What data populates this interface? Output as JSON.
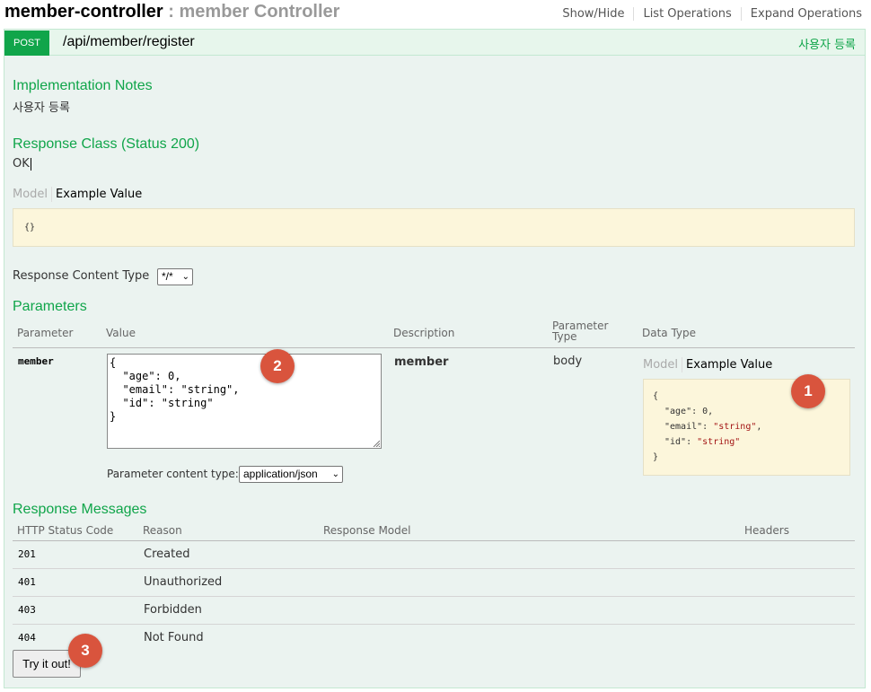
{
  "header": {
    "controller_name": "member-controller",
    "separator": " : ",
    "controller_description": "member Controller",
    "links": [
      "Show/Hide",
      "List Operations",
      "Expand Operations"
    ]
  },
  "operation": {
    "method": "POST",
    "path": "/api/member/register",
    "summary": "사용자 등록"
  },
  "implementation_notes": {
    "heading": "Implementation Notes",
    "text": "사용자 등록"
  },
  "response_class": {
    "heading": "Response Class (Status 200)",
    "text": "OK",
    "tab_model": "Model",
    "tab_example": "Example Value",
    "example": "{}"
  },
  "response_content_type": {
    "label": "Response Content Type",
    "value": "*/*"
  },
  "parameters": {
    "heading": "Parameters",
    "columns": [
      "Parameter",
      "Value",
      "Description",
      "Parameter Type",
      "Data Type"
    ],
    "rows": [
      {
        "name": "member",
        "value_lines": [
          "{",
          "  \"age\": 0,",
          "  \"email\": \"string\",",
          "  \"id\": \"string\"",
          "}"
        ],
        "description": "member",
        "param_type": "body",
        "tab_model": "Model",
        "tab_example": "Example Value",
        "example": {
          "open": "{",
          "age_key": "\"age\"",
          "age_val": "0,",
          "email_key": "\"email\"",
          "email_val": "\"string\"",
          "email_comma": ",",
          "id_key": "\"id\"",
          "id_val": "\"string\"",
          "close": "}"
        }
      }
    ],
    "content_type_label": "Parameter content type:",
    "content_type_value": "application/json"
  },
  "response_messages": {
    "heading": "Response Messages",
    "columns": [
      "HTTP Status Code",
      "Reason",
      "Response Model",
      "Headers"
    ],
    "rows": [
      {
        "code": "201",
        "reason": "Created"
      },
      {
        "code": "401",
        "reason": "Unauthorized"
      },
      {
        "code": "403",
        "reason": "Forbidden"
      },
      {
        "code": "404",
        "reason": "Not Found"
      }
    ]
  },
  "try_button": "Try it out!",
  "markers": [
    "1",
    "2",
    "3"
  ],
  "colors": {
    "accent_green": "#10a54a",
    "op_background": "#ebf3f0",
    "sample_background": "#fcf6db",
    "marker_red": "#d9543d"
  }
}
